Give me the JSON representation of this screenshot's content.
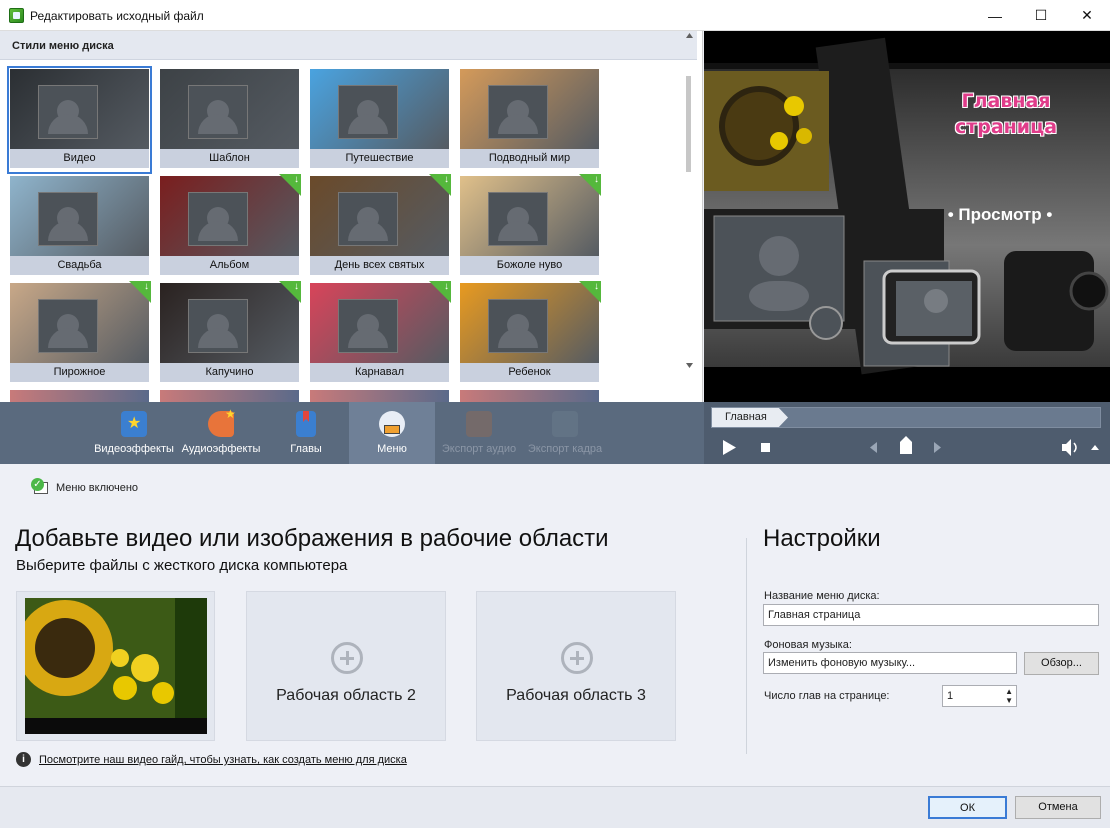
{
  "window": {
    "title": "Редактировать исходный файл",
    "minimize": "—",
    "maximize": "☐",
    "close": "✕"
  },
  "styles": {
    "header": "Стили меню диска",
    "tiles": [
      {
        "label": "Видео",
        "selected": true,
        "download": false
      },
      {
        "label": "Шаблон",
        "selected": false,
        "download": false
      },
      {
        "label": "Путешествие",
        "selected": false,
        "download": false
      },
      {
        "label": "Подводный мир",
        "selected": false,
        "download": false
      },
      {
        "label": "Свадьба",
        "selected": false,
        "download": false
      },
      {
        "label": "Альбом",
        "selected": false,
        "download": true
      },
      {
        "label": "День всех святых",
        "selected": false,
        "download": true
      },
      {
        "label": "Божоле нуво",
        "selected": false,
        "download": true
      },
      {
        "label": "Пирожное",
        "selected": false,
        "download": true
      },
      {
        "label": "Капучино",
        "selected": false,
        "download": true
      },
      {
        "label": "Карнавал",
        "selected": false,
        "download": true
      },
      {
        "label": "Ребенок",
        "selected": false,
        "download": true
      }
    ]
  },
  "preview": {
    "title_line1": "Главная",
    "title_line2": "страница",
    "browse": "• Просмотр •"
  },
  "toolbar": {
    "video_effects": "Видеоэффекты",
    "audio_effects": "Аудиоэффекты",
    "chapters": "Главы",
    "menu": "Меню",
    "export_audio": "Экспорт аудио",
    "export_frame": "Экспорт кадра"
  },
  "player": {
    "chapter_tab": "Главная"
  },
  "menu_enabled": {
    "label": "Меню включено",
    "checked": true
  },
  "main": {
    "heading": "Добавьте видео или изображения в рабочие области",
    "subheading": "Выберите файлы с жесткого диска компьютера",
    "area2": "Рабочая область 2",
    "area3": "Рабочая область 3",
    "guide_link": "Посмотрите наш видео гайд, чтобы узнать, как создать меню для диска"
  },
  "settings": {
    "heading": "Настройки",
    "menu_name_label": "Название меню диска:",
    "menu_name_value": "Главная страница",
    "music_label": "Фоновая музыка:",
    "music_value": "Изменить фоновую музыку...",
    "browse_button": "Обзор...",
    "chapters_label": "Число глав на странице:",
    "chapters_value": "1"
  },
  "footer": {
    "ok": "ОК",
    "cancel": "Отмена"
  },
  "colors": {
    "accent": "#3a7bd5",
    "download_badge": "#55b83c",
    "toolbar": "#5a6a7e",
    "menu_active": "#6f8097"
  }
}
